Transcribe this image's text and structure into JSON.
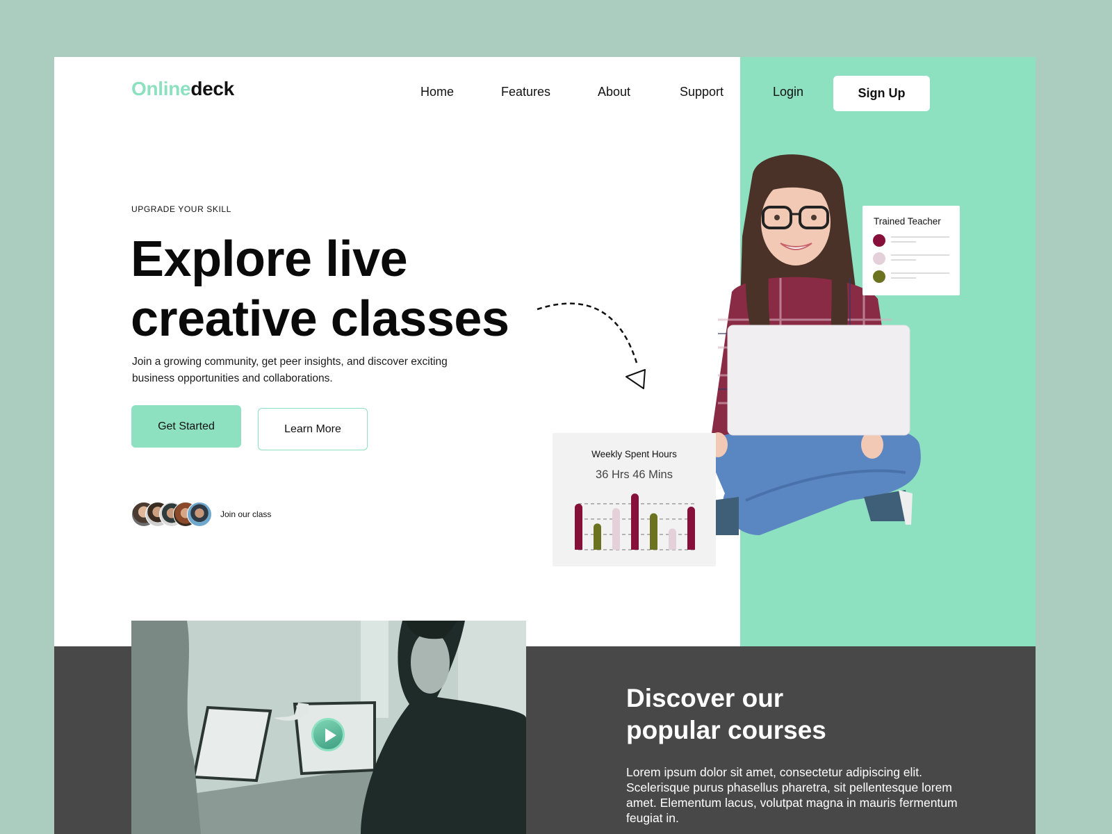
{
  "brand": {
    "name_accent": "Online",
    "name_rest": "deck",
    "accent_color": "#8de0c0"
  },
  "nav": {
    "items": [
      {
        "label": "Home"
      },
      {
        "label": "Features"
      },
      {
        "label": "About"
      },
      {
        "label": "Support"
      },
      {
        "label": "Login"
      }
    ],
    "signup_label": "Sign Up"
  },
  "hero": {
    "eyebrow": "UPGRADE YOUR SKILL",
    "headline_line1": "Explore live",
    "headline_line2": "creative classes",
    "subtext": "Join a growing community, get peer insights, and discover exciting business opportunities and collaborations.",
    "primary_cta": "Get Started",
    "secondary_cta": "Learn More",
    "join_label": "Join our class",
    "avatar_count": 5
  },
  "teacher_card": {
    "title": "Trained Teacher",
    "items": [
      {
        "color": "#86103a"
      },
      {
        "color": "#e3d0d8"
      },
      {
        "color": "#6b7220"
      }
    ]
  },
  "weekly_card": {
    "title": "Weekly Spent Hours",
    "value": "36 Hrs 46 Mins"
  },
  "chart_data": {
    "type": "bar",
    "title": "Weekly Spent Hours",
    "categories": [
      "1",
      "2",
      "3",
      "4",
      "5",
      "6",
      "7"
    ],
    "values": [
      63,
      36,
      57,
      77,
      50,
      29,
      59
    ],
    "colors": [
      "#86103a",
      "#6b7220",
      "#e3d0d8",
      "#86103a",
      "#6b7220",
      "#e3d0d8",
      "#86103a"
    ],
    "ylim": [
      0,
      80
    ],
    "gridlines": [
      0,
      21,
      42,
      63
    ],
    "grid": true,
    "xlabel": "",
    "ylabel": ""
  },
  "courses": {
    "title_line1": "Discover our",
    "title_line2": "popular courses",
    "text": "Lorem ipsum dolor sit amet, consectetur adipiscing elit. Scelerisque purus phasellus pharetra, sit pellentesque lorem amet. Elementum lacus, volutpat magna in mauris fermentum feugiat in."
  },
  "colors": {
    "page_bg": "#abcdc0",
    "green_panel": "#8de0c0",
    "dark_band": "#484848"
  }
}
